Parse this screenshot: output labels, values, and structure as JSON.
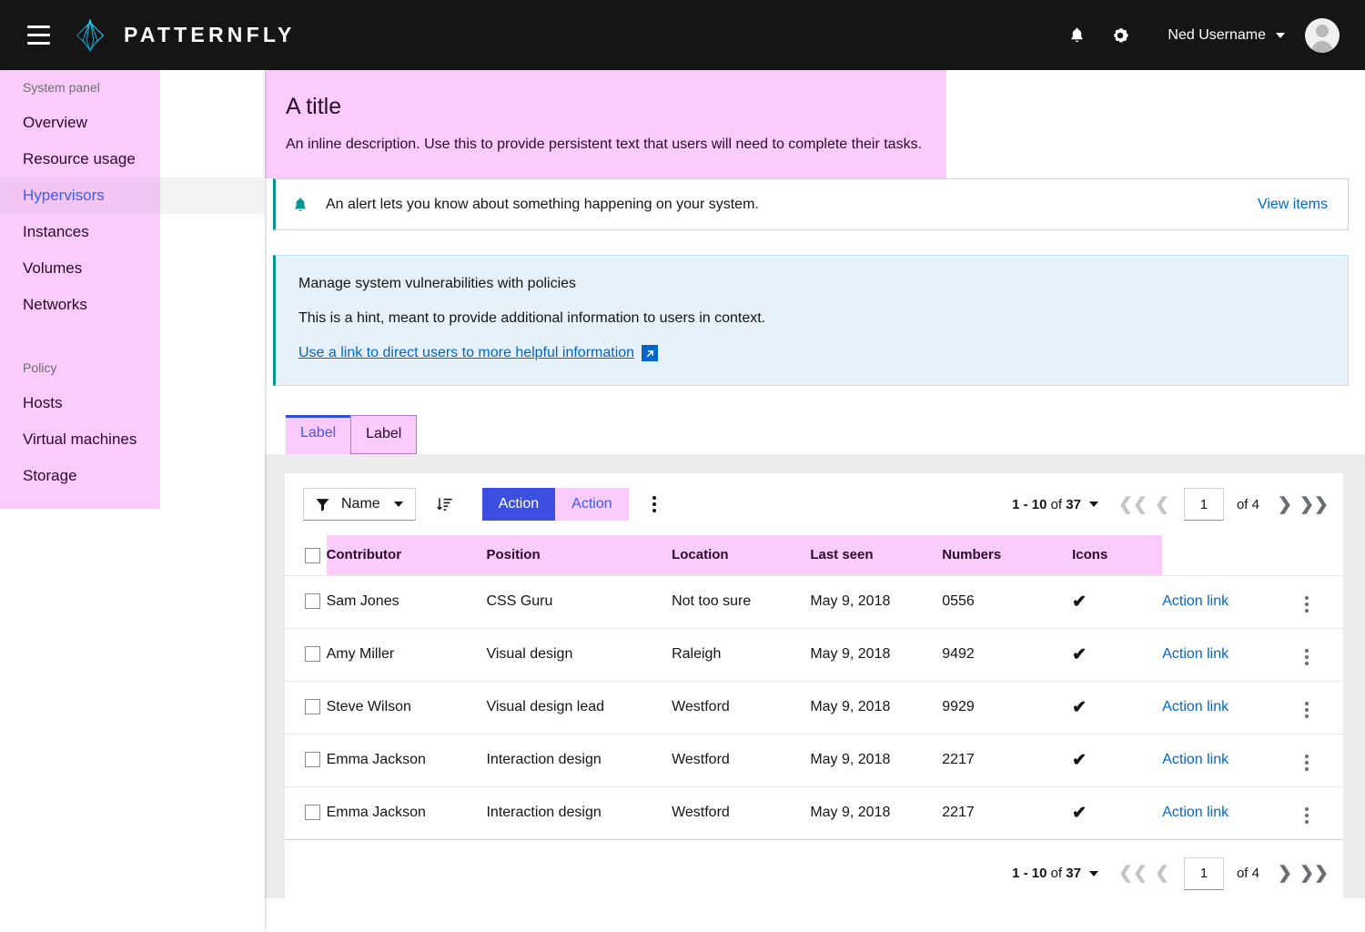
{
  "masthead": {
    "hamburger_label": "global-navigation-toggle",
    "brand_name": "PATTERNFLY",
    "notification_icon": "bell-icon",
    "settings_icon": "gear-icon",
    "username": "Ned Username",
    "avatar_label": "user-avatar"
  },
  "sidebar": {
    "groups": [
      {
        "title": "System panel",
        "items": [
          {
            "label": "Overview",
            "active": false
          },
          {
            "label": "Resource usage",
            "active": false
          },
          {
            "label": "Hypervisors",
            "active": true
          },
          {
            "label": "Instances",
            "active": false
          },
          {
            "label": "Volumes",
            "active": false
          },
          {
            "label": "Networks",
            "active": false
          }
        ]
      },
      {
        "title": "Policy",
        "items": [
          {
            "label": "Hosts",
            "active": false
          },
          {
            "label": "Virtual machines",
            "active": false
          },
          {
            "label": "Storage",
            "active": false
          }
        ]
      }
    ]
  },
  "page_header": {
    "title": "A title",
    "description": "An inline description. Use this to provide persistent text that users will need to complete their tasks."
  },
  "alert": {
    "icon": "bell-icon",
    "text": "An alert lets you know about something happening on your system.",
    "link": "View items"
  },
  "hint": {
    "title": "Manage system vulnerabilities with policies",
    "body": "This is a hint, meant to provide additional information to users in context.",
    "link": "Use a link to direct users to more helpful information",
    "link_icon": "external-link-icon"
  },
  "tabs": [
    {
      "label": "Label",
      "active": true
    },
    {
      "label": "Label",
      "active": false
    }
  ],
  "toolbar": {
    "filter_label": "Name",
    "filter_icon": "filter-funnel-icon",
    "sort_icon": "sort-amount-down-icon",
    "primary_action": "Action",
    "secondary_action": "Action",
    "kebab_icon": "kebab-vertical-icon"
  },
  "pagination": {
    "range": "1 - 10",
    "of_label": "of",
    "total": "37",
    "page_value": "1",
    "page_of": "of 4",
    "first_icon": "angle-double-left-icon",
    "prev_icon": "angle-left-icon",
    "next_icon": "angle-right-icon",
    "last_icon": "angle-double-right-icon"
  },
  "table": {
    "columns": [
      "Contributor",
      "Position",
      "Location",
      "Last seen",
      "Numbers",
      "Icons"
    ],
    "rows": [
      {
        "contributor": "Sam Jones",
        "position": "CSS Guru",
        "location": "Not too sure",
        "last_seen": "May 9, 2018",
        "numbers": "0556",
        "icon": "check-icon",
        "action": "Action link"
      },
      {
        "contributor": "Amy Miller",
        "position": "Visual design",
        "location": "Raleigh",
        "last_seen": "May 9, 2018",
        "numbers": "9492",
        "icon": "check-icon",
        "action": "Action link"
      },
      {
        "contributor": "Steve Wilson",
        "position": "Visual design lead",
        "location": "Westford",
        "last_seen": "May 9, 2018",
        "numbers": "9929",
        "icon": "check-icon",
        "action": "Action link"
      },
      {
        "contributor": "Emma Jackson",
        "position": "Interaction design",
        "location": "Westford",
        "last_seen": "May 9, 2018",
        "numbers": "2217",
        "icon": "check-icon",
        "action": "Action link"
      },
      {
        "contributor": "Emma Jackson",
        "position": "Interaction design",
        "location": "Westford",
        "last_seen": "May 9, 2018",
        "numbers": "2217",
        "icon": "check-icon",
        "action": "Action link"
      }
    ]
  },
  "colors": {
    "masthead_bg": "#151515",
    "brand_accent": "#00b9e4",
    "highlight_pink": "#fbcbfb",
    "active_link_blue": "#3d5bf5",
    "primary_button": "#3c4fe0",
    "link_blue": "#0066cc",
    "teal_accent": "#009596",
    "hint_bg": "#e7f1fa",
    "content_bg": "#ececec"
  }
}
